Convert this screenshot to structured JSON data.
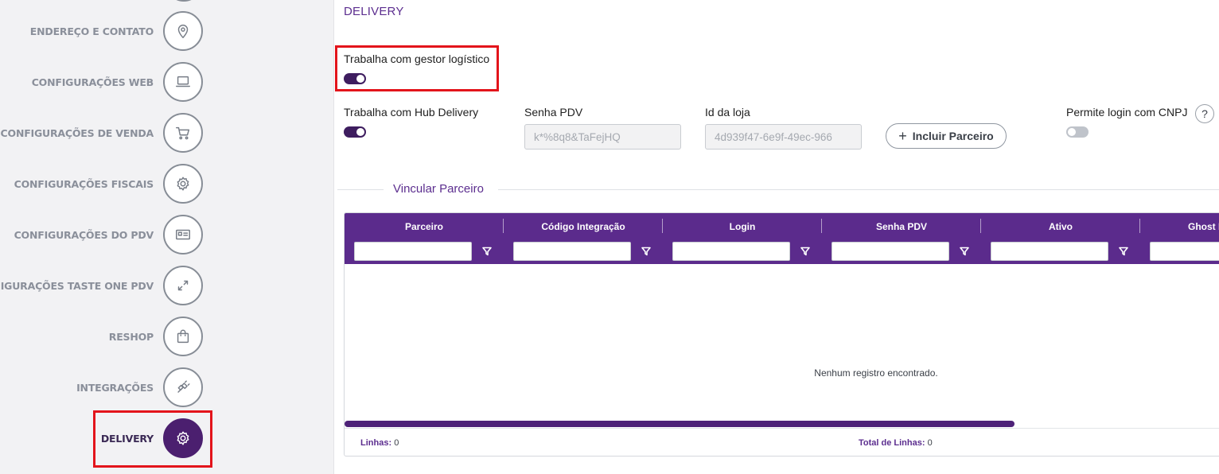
{
  "sidebar": {
    "items": [
      {
        "label": "ENDEREÇO E CONTATO",
        "icon": "map-pin-icon"
      },
      {
        "label": "CONFIGURAÇÕES WEB",
        "icon": "laptop-icon"
      },
      {
        "label": "CONFIGURAÇÕES DE VENDA",
        "icon": "cart-icon"
      },
      {
        "label": "CONFIGURAÇÕES FISCAIS",
        "icon": "gear-icon"
      },
      {
        "label": "CONFIGURAÇÕES DO PDV",
        "icon": "id-card-icon"
      },
      {
        "label": "CONFIGURAÇÕES TASTE ONE PDV",
        "icon": "expand-icon"
      },
      {
        "label": "RESHOP",
        "icon": "shopping-bag-icon"
      },
      {
        "label": "INTEGRAÇÕES",
        "icon": "plug-icon"
      },
      {
        "label": "DELIVERY",
        "icon": "gear-icon",
        "active": true
      }
    ]
  },
  "main": {
    "title": "DELIVERY",
    "gestor_logistico": {
      "label": "Trabalha com gestor logístico",
      "value": true
    },
    "hub_delivery": {
      "label": "Trabalha com Hub Delivery",
      "value": true
    },
    "senha_pdv": {
      "label": "Senha PDV",
      "value": "k*%8q8&TaFejHQ"
    },
    "id_loja": {
      "label": "Id da loja",
      "value": "4d939f47-6e9f-49ec-966"
    },
    "incluir_button": "Incluir Parceiro",
    "login_cnpj": {
      "label": "Permite login com CNPJ",
      "value": false,
      "help": "?"
    },
    "vincular_title": "Vincular Parceiro",
    "grid": {
      "columns": [
        "Parceiro",
        "Código Integração",
        "Login",
        "Senha PDV",
        "Ativo",
        "Ghost Ki"
      ],
      "empty_message": "Nenhum registro encontrado.",
      "footer": {
        "linhas_label": "Linhas:",
        "linhas_value": "0",
        "total_label": "Total de Linhas:",
        "total_value": "0"
      },
      "horizontal_scroll_fraction": 0.76
    }
  },
  "colors": {
    "accent": "#5b2b8c",
    "active_nav": "#4b1f6f",
    "highlight": "#e3141b"
  }
}
